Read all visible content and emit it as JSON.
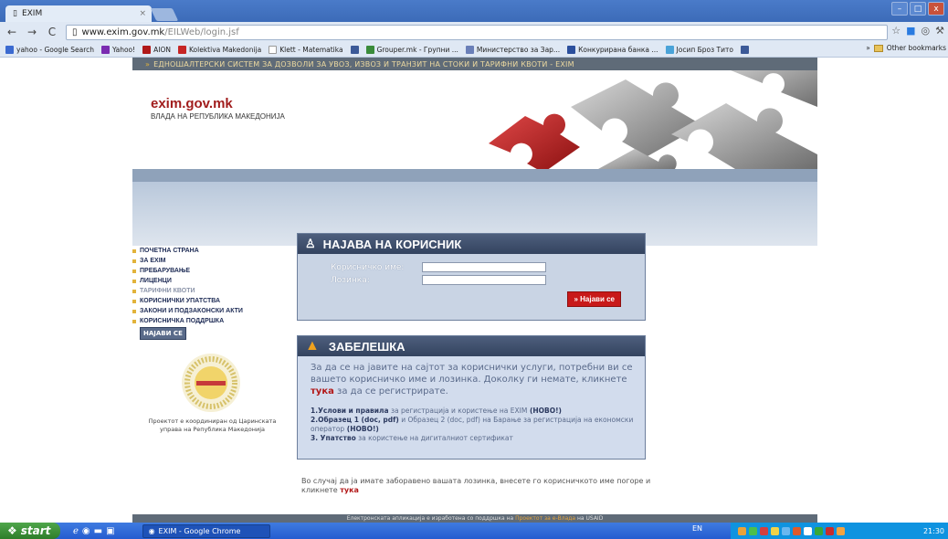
{
  "browser": {
    "tab_title": "EXIM",
    "tab_close": "×",
    "url_domain": "www.exim.gov.mk",
    "url_path": "/EILWeb/login.jsf",
    "back": "←",
    "forward": "→",
    "reload": "C",
    "win_min": "–",
    "win_max": "□",
    "win_close": "x",
    "bookmarks": [
      {
        "label": "yahoo - Google Search",
        "color": "#3b6ad0"
      },
      {
        "label": "Yahoo!",
        "color": "#7b2cb1"
      },
      {
        "label": "AION",
        "color": "#b01818"
      },
      {
        "label": "Kolektiva Makedonija",
        "color": "#c62525"
      },
      {
        "label": "Klett - Matematika",
        "color": "#ffffff"
      },
      {
        "label": "",
        "color": "#3b5998"
      },
      {
        "label": "Grouper.mk - Групни ...",
        "color": "#3a8b3a"
      },
      {
        "label": "Министерство за Зар...",
        "color": "#6a7fb8"
      },
      {
        "label": "Конкурирана банка ...",
        "color": "#2b4f9d"
      },
      {
        "label": "Јосип Броз Тито",
        "color": "#4aa3d8"
      },
      {
        "label": "",
        "color": "#3b5998"
      }
    ],
    "other_bookmarks": "Other bookmarks"
  },
  "page": {
    "top_strip": "ЕДНОШАЛТЕРСКИ СИСТЕМ ЗА ДОЗВОЛИ ЗА УВОЗ, ИЗВОЗ И ТРАНЗИТ НА СТОКИ И ТАРИФНИ КВОТИ - EXIM",
    "site_name": "exim.gov.mk",
    "site_sub": "ВЛАДА НА РЕПУБЛИКА МАКЕДОНИЈА",
    "nav": [
      {
        "label": "ПОЧЕТНА СТРАНА",
        "dim": false
      },
      {
        "label": "ЗА EXIM",
        "dim": false
      },
      {
        "label": "ПРЕБАРУВАЊЕ",
        "dim": false
      },
      {
        "label": "ЛИЦЕНЦИ",
        "dim": false
      },
      {
        "label": "ТАРИФНИ КВОТИ",
        "dim": true
      },
      {
        "label": "КОРИСНИЧКИ УПАТСТВА",
        "dim": false
      },
      {
        "label": "ЗАКОНИ И ПОДЗАКОНСКИ АКТИ",
        "dim": false
      },
      {
        "label": "КОРИСНИЧКА ПОДДРШКА",
        "dim": false
      }
    ],
    "logout_label": "НАЈАВИ СЕ",
    "seal_caption": "Проектот е координиран од Царинската управа на Република Македонија",
    "login": {
      "title": "НАЈАВА НА КОРИСНИК",
      "username_label": "Корисничко име:",
      "password_label": "Лозинка:",
      "button": "» Најави се"
    },
    "note": {
      "title": "ЗАБЕЛЕШКА",
      "text_before": "За да се на јавите на сајтот за кориснички услуги, потребни ви се вашето корисничко име и лозинка. Доколку ги немате, кликнете",
      "link": "тука",
      "text_after": "за да се регистрирате.",
      "items": [
        {
          "bold": "1.Услови и правила",
          "rest": " за регистрација и користење на EXIM",
          "tag": " (НОВО!)"
        },
        {
          "bold": "2.Образец 1 (doc, pdf)",
          "rest": " и Образец 2 (doc, pdf) на Барање за регистрација на економски оператор",
          "tag": " (НОВО!)"
        },
        {
          "bold": "3. Упатство",
          "rest": " за користење на дигиталниот сертификат",
          "tag": ""
        }
      ]
    },
    "forgot_text": "Во случај да ја имате заборавено вашата лозинка, внесете го корисничкото име погоре и кликнете",
    "forgot_link": "тука",
    "footer_text": "Електронската апликација е изработена со поддршка на",
    "footer_link": "Проектот за е-Влада",
    "footer_org": "на USAID"
  },
  "taskbar": {
    "start": "start",
    "task": "EXIM - Google Chrome",
    "lang": "EN",
    "clock": "21:30"
  }
}
